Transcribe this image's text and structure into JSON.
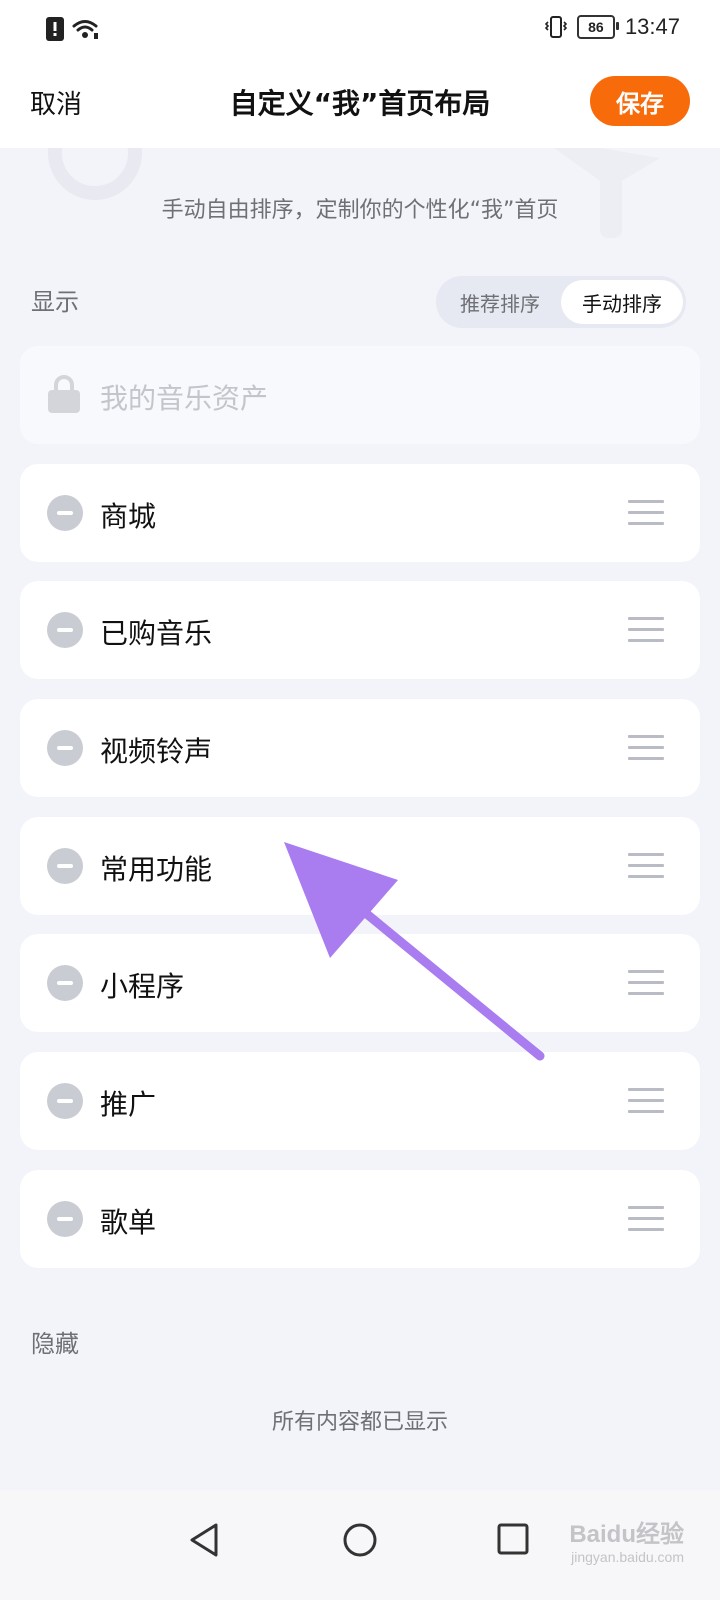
{
  "status_bar": {
    "time": "13:47",
    "battery": "86"
  },
  "header": {
    "cancel_label": "取消",
    "title": "自定义“我”首页布局",
    "save_label": "保存"
  },
  "subtitle": "手动自由排序，定制你的个性化“我”首页",
  "display_section": {
    "label": "显示",
    "sort_toggle": {
      "options": [
        "推荐排序",
        "手动排序"
      ],
      "selected": "手动排序"
    },
    "locked_item": "我的音乐资产",
    "items": [
      "商城",
      "已购音乐",
      "视频铃声",
      "常用功能",
      "小程序",
      "推广",
      "歌单"
    ]
  },
  "hidden_section": {
    "label": "隐藏",
    "empty_text": "所有内容都已显示"
  },
  "annotation": {
    "arrow_color": "#a97cf0"
  },
  "accent_color": "#f76b0a",
  "watermark": {
    "logo": "Baidu经验",
    "url": "jingyan.baidu.com"
  }
}
